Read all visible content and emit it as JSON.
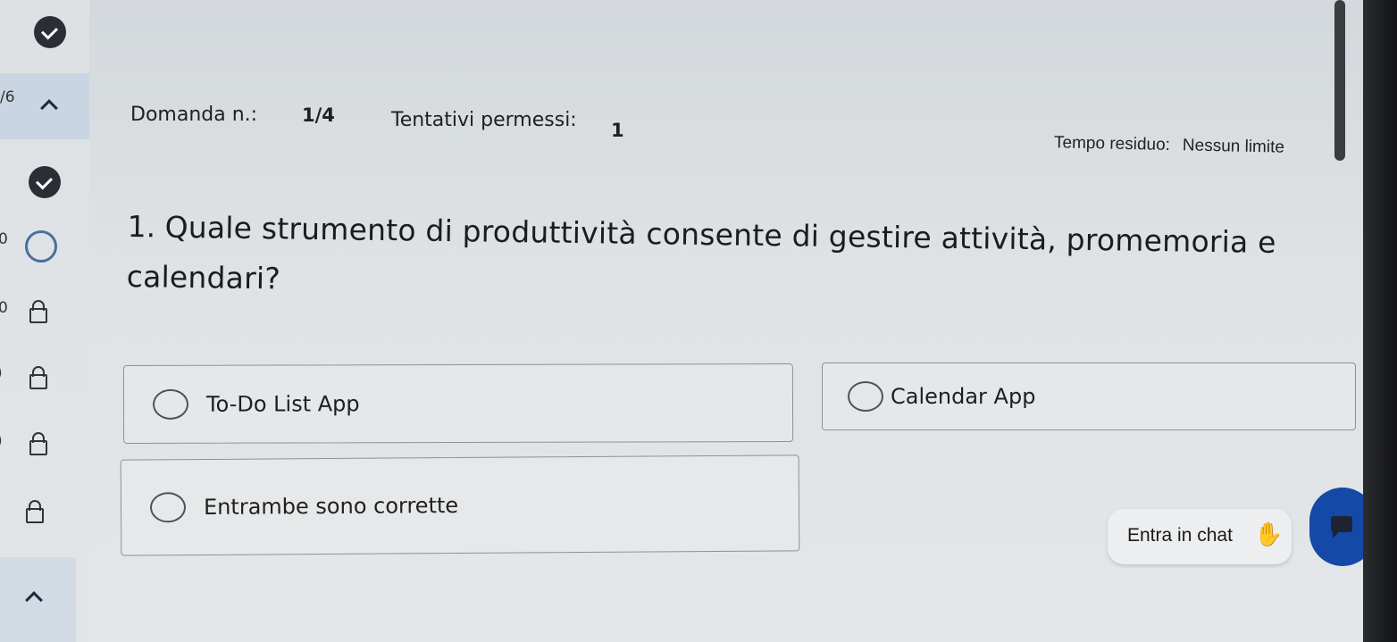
{
  "sidebar": {
    "section_number": "/6",
    "question_markers": [
      "0",
      "0",
      ")",
      ")"
    ]
  },
  "header": {
    "question_label": "Domanda n.:",
    "question_value": "1/4",
    "attempts_label": "Tentativi permessi:",
    "attempts_value": "1",
    "time_label": "Tempo residuo:",
    "time_value": "Nessun limite"
  },
  "question": {
    "number": "1.",
    "text": "Quale strumento di produttività consente di gestire attività, promemoria e calendari?"
  },
  "options": [
    {
      "label": "To-Do List App"
    },
    {
      "label": "Calendar App"
    },
    {
      "label": "Entrambe sono corrette"
    }
  ],
  "chat": {
    "label": "Entra in chat",
    "wave_icon": "waving-hand-icon",
    "button_icon": "chat-bubble-icon",
    "button_color": "#1549a8"
  },
  "colors": {
    "accent": "#1549a8",
    "sidebar_active": "#c9d5e2"
  }
}
